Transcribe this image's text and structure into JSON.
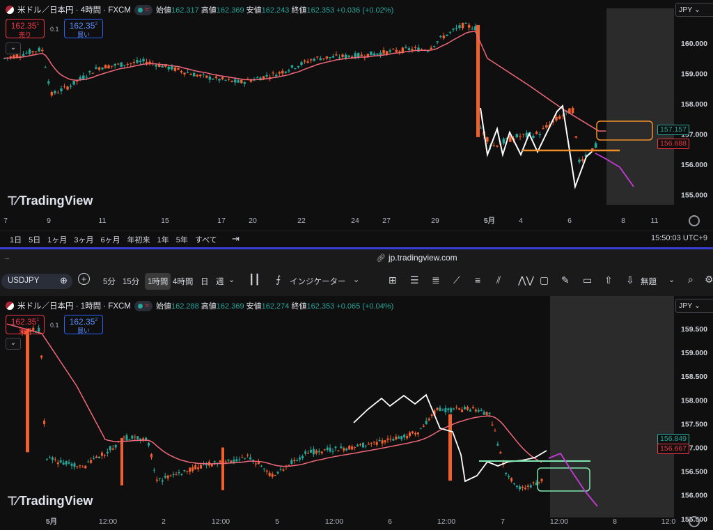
{
  "top": {
    "title": "米ドル／日本円 · 4時間 · FXCM",
    "ohlc": {
      "o_label": "始値",
      "o": "162.317",
      "h_label": "高値",
      "h": "162.369",
      "l_label": "安値",
      "l": "162.243",
      "c_label": "終値",
      "c": "162.353",
      "chg": "+0.036 (+0.02%)"
    },
    "sell": {
      "price": "162.35",
      "sup": "1",
      "label": "売り"
    },
    "spread": "0.1",
    "buy": {
      "price": "162.35",
      "sup": "2",
      "label": "買い"
    },
    "currency": "JPY",
    "y_ticks": [
      "160.000",
      "159.000",
      "158.000",
      "157.000",
      "156.000",
      "155.000"
    ],
    "x_ticks": [
      "7",
      "9",
      "11",
      "15",
      "17",
      "20",
      "22",
      "24",
      "27",
      "29",
      "5月",
      "4",
      "6",
      "8",
      "11"
    ],
    "tag_green": "157.157",
    "tag_red": "156.688",
    "watermark": "TradingView",
    "ranges": [
      "1日",
      "5日",
      "1ヶ月",
      "3ヶ月",
      "6ヶ月",
      "年初来",
      "1年",
      "5年",
      "すべて"
    ],
    "clock": "15:50:03 UTC+9"
  },
  "url": "jp.tradingview.com",
  "toolbar": {
    "symbol": "USDJPY",
    "intervals": [
      "5分",
      "15分",
      "1時間",
      "4時間",
      "日",
      "週"
    ],
    "active_interval": "1時間",
    "indicators": "インジケーター",
    "layout_name": "無題"
  },
  "bottom": {
    "title": "米ドル／日本円 · 1時間 · FXCM",
    "ohlc": {
      "o_label": "始値",
      "o": "162.288",
      "h_label": "高値",
      "h": "162.369",
      "l_label": "安値",
      "l": "162.274",
      "c_label": "終値",
      "c": "162.353",
      "chg": "+0.065 (+0.04%)"
    },
    "sell": {
      "price": "162.35",
      "sup": "1",
      "label": "売り"
    },
    "spread": "0.1",
    "buy": {
      "price": "162.35",
      "sup": "2",
      "label": "買い"
    },
    "currency": "JPY",
    "y_ticks": [
      "159.500",
      "159.000",
      "158.500",
      "158.000",
      "157.500",
      "157.000",
      "156.500",
      "156.000",
      "155.500"
    ],
    "x_ticks": [
      "5月",
      "12:00",
      "2",
      "12:00",
      "5",
      "12:00",
      "6",
      "12:00",
      "7",
      "12:00",
      "8",
      "12:0"
    ],
    "tag_green": "156.849",
    "tag_red": "156.667",
    "watermark": "TradingView"
  },
  "colors": {
    "up": "#26a69a",
    "down": "#f0602c",
    "ma": "#f0687a",
    "accent": "#2962ff",
    "forecast": "#c63bd6",
    "box_orange": "#f0902c",
    "box_green": "#7ee8b0"
  }
}
